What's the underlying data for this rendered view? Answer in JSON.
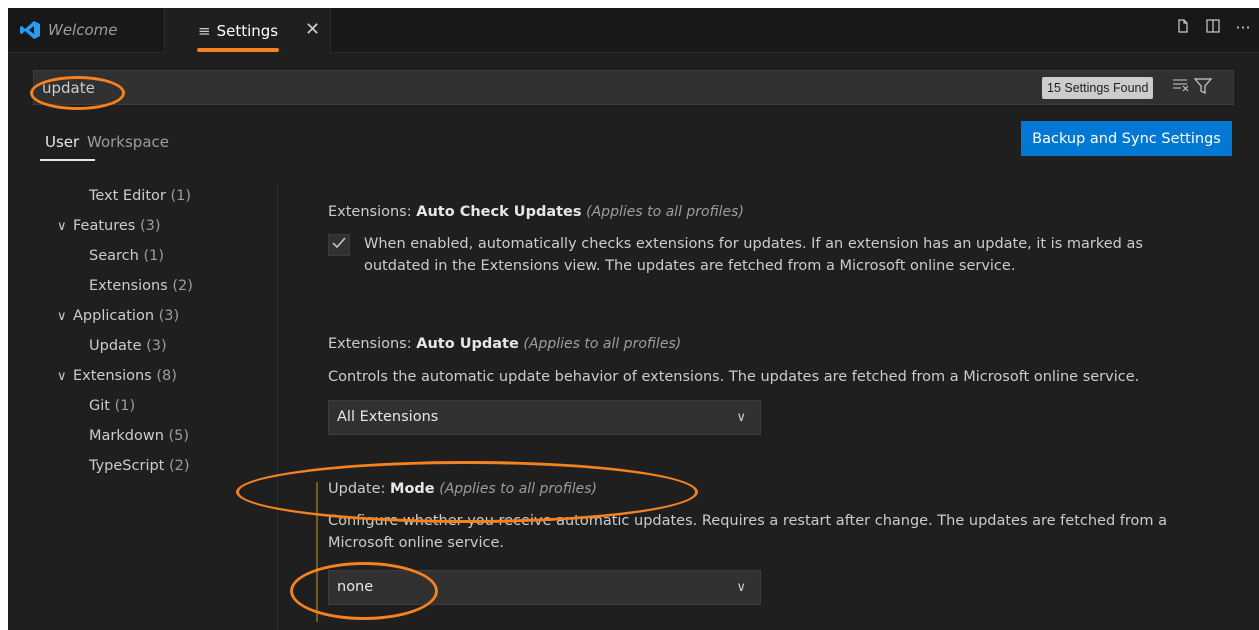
{
  "tabs": [
    {
      "label": "Welcome"
    },
    {
      "label": "Settings",
      "close": "✕",
      "icon": "settings-list-icon"
    }
  ],
  "tabbar_actions": [
    "open-json-icon",
    "split-editor-icon",
    "more-actions-icon"
  ],
  "search": {
    "value": "update",
    "found": "15 Settings Found"
  },
  "scope_tabs": [
    "User",
    "Workspace"
  ],
  "sync_button": "Backup and Sync Settings",
  "toc": [
    {
      "label": "Text Editor",
      "count": "(1)",
      "chevron": ""
    },
    {
      "label": "Features",
      "count": "(3)",
      "chevron": "∨"
    },
    {
      "label": "Search",
      "count": "(1)",
      "chevron": ""
    },
    {
      "label": "Extensions",
      "count": "(2)",
      "chevron": ""
    },
    {
      "label": "Application",
      "count": "(3)",
      "chevron": "∨"
    },
    {
      "label": "Update",
      "count": "(3)",
      "chevron": ""
    },
    {
      "label": "Extensions",
      "count": "(8)",
      "chevron": "∨"
    },
    {
      "label": "Git",
      "count": "(1)",
      "chevron": ""
    },
    {
      "label": "Markdown",
      "count": "(5)",
      "chevron": ""
    },
    {
      "label": "TypeScript",
      "count": "(2)",
      "chevron": ""
    }
  ],
  "settings": [
    {
      "category": "Extensions: ",
      "name": "Auto Check Updates",
      "scope": "(Applies to all profiles)",
      "desc_line1": "When enabled, automatically checks extensions for updates. If an extension has an update, it is marked as",
      "desc_line2": "outdated in the Extensions view. The updates are fetched from a Microsoft online service.",
      "checked": true
    },
    {
      "category": "Extensions: ",
      "name": "Auto Update",
      "scope": "(Applies to all profiles)",
      "desc_line1": "Controls the automatic update behavior of extensions. The updates are fetched from a Microsoft online service.",
      "value": "All Extensions"
    },
    {
      "category": "Update: ",
      "name": "Mode",
      "scope": "(Applies to all profiles)",
      "desc_line1": "Configure whether you receive automatic updates. Requires a restart after change. The updates are fetched from a",
      "desc_line2": "Microsoft online service.",
      "value": "none"
    }
  ],
  "colors": {
    "background": "#1f1f1f",
    "accent_button": "#0078d4",
    "annotation": "#f5821f"
  }
}
